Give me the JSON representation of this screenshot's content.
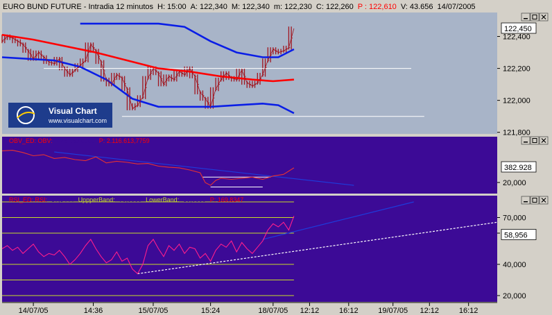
{
  "header": {
    "parts": [
      {
        "text": "EURO BUND FUTURE - Intradia 12 minutos",
        "color": "#000000"
      },
      {
        "text": "H: 15:00",
        "color": "#000000"
      },
      {
        "text": "A: 122,340",
        "color": "#000000"
      },
      {
        "text": "M: 122,340",
        "color": "#000000"
      },
      {
        "text": "m: 122,230",
        "color": "#000000"
      },
      {
        "text": "C: 122,260",
        "color": "#000000"
      },
      {
        "text": "P : 122,610",
        "color": "#ff0000"
      },
      {
        "text": "V: 43.656",
        "color": "#000000"
      },
      {
        "text": "14/07/2005",
        "color": "#000000"
      }
    ]
  },
  "logo": {
    "brand": "Visual Chart",
    "url": "www.visualchart.com"
  },
  "colors": {
    "price_bg": "#a8b4c8",
    "indicator_bg": "#3c0a96",
    "price_bars": "#a0141e",
    "moving_average": "#ff0000",
    "bands": "#0a1ee6",
    "obv_line": "#e63232",
    "rsi_line": "#ff1e8c",
    "trendline": "#1e3cdc",
    "threshold": "#c8dc28",
    "support": "#ffffff"
  },
  "chart_data": [
    {
      "type": "line",
      "panel": "price",
      "series": [
        {
          "name": "price",
          "points": [
            [
              0,
              122.37
            ],
            [
              2,
              122.4
            ],
            [
              4,
              122.39
            ],
            [
              6,
              122.37
            ],
            [
              8,
              122.35
            ],
            [
              10,
              122.31
            ],
            [
              12,
              122.26
            ],
            [
              14,
              122.3
            ],
            [
              16,
              122.27
            ],
            [
              18,
              122.24
            ],
            [
              20,
              122.23
            ],
            [
              22,
              122.26
            ],
            [
              24,
              122.2
            ],
            [
              26,
              122.16
            ],
            [
              28,
              122.19
            ],
            [
              30,
              122.22
            ],
            [
              32,
              122.25
            ],
            [
              34,
              122.35
            ],
            [
              36,
              122.31
            ],
            [
              38,
              122.24
            ],
            [
              40,
              122.13
            ],
            [
              42,
              122.1
            ],
            [
              44,
              122.16
            ],
            [
              46,
              122.14
            ],
            [
              48,
              122.07
            ],
            [
              50,
              121.95
            ],
            [
              52,
              121.97
            ],
            [
              54,
              122.02
            ],
            [
              56,
              122.14
            ],
            [
              58,
              122.2
            ],
            [
              60,
              122.17
            ],
            [
              62,
              122.1
            ],
            [
              64,
              122.15
            ],
            [
              66,
              122.13
            ],
            [
              68,
              122.18
            ],
            [
              70,
              122.16
            ],
            [
              72,
              122.2
            ],
            [
              74,
              122.15
            ],
            [
              76,
              122.05
            ],
            [
              78,
              122.01
            ],
            [
              80,
              121.96
            ],
            [
              82,
              122.07
            ],
            [
              84,
              122.13
            ],
            [
              86,
              122.17
            ],
            [
              88,
              122.14
            ],
            [
              90,
              122.13
            ],
            [
              92,
              122.19
            ],
            [
              94,
              122.11
            ],
            [
              96,
              122.09
            ],
            [
              98,
              122.11
            ],
            [
              100,
              122.16
            ],
            [
              102,
              122.25
            ],
            [
              104,
              122.32
            ],
            [
              106,
              122.3
            ],
            [
              108,
              122.31
            ],
            [
              110,
              122.33
            ],
            [
              112,
              122.45
            ]
          ]
        },
        {
          "name": "media",
          "points": [
            [
              0,
              122.41
            ],
            [
              12,
              122.38
            ],
            [
              24,
              122.34
            ],
            [
              36,
              122.3
            ],
            [
              48,
              122.25
            ],
            [
              60,
              122.2
            ],
            [
              72,
              122.18
            ],
            [
              84,
              122.15
            ],
            [
              96,
              122.13
            ],
            [
              104,
              122.12
            ],
            [
              112,
              122.13
            ]
          ]
        },
        {
          "name": "banda-superior",
          "points": [
            [
              30,
              122.48
            ],
            [
              40,
              122.48
            ],
            [
              50,
              122.48
            ],
            [
              60,
              122.48
            ],
            [
              70,
              122.46
            ],
            [
              80,
              122.37
            ],
            [
              90,
              122.3
            ],
            [
              100,
              122.27
            ],
            [
              106,
              122.27
            ],
            [
              112,
              122.32
            ]
          ]
        },
        {
          "name": "banda-inferior",
          "points": [
            [
              0,
              122.27
            ],
            [
              10,
              122.26
            ],
            [
              20,
              122.25
            ],
            [
              30,
              122.21
            ],
            [
              40,
              122.13
            ],
            [
              50,
              122.01
            ],
            [
              60,
              121.96
            ],
            [
              70,
              121.96
            ],
            [
              80,
              121.96
            ],
            [
              90,
              121.97
            ],
            [
              100,
              121.98
            ],
            [
              106,
              121.97
            ],
            [
              112,
              121.92
            ]
          ]
        },
        {
          "name": "soporte-superior",
          "points": [
            [
              16,
              122.2
            ],
            [
              157,
              122.2
            ]
          ]
        },
        {
          "name": "soporte-inferior",
          "points": [
            [
              46,
              121.9
            ],
            [
              162,
              121.9
            ]
          ]
        }
      ],
      "current_value": "122,450",
      "ylim": [
        121.79,
        122.55
      ],
      "yticks": [
        "122,400",
        "122,200",
        "122,000",
        "121,800"
      ]
    },
    {
      "type": "line",
      "panel": "obv",
      "legend": [
        {
          "text": "OBV_ED: OBV:",
          "color": "#ff0000"
        },
        {
          "text": "426.160,0000",
          "color": "#3c0a96"
        },
        {
          "text": "P: 2.116.613,7759",
          "color": "#ff0000"
        }
      ],
      "series": [
        {
          "name": "obv",
          "points": [
            [
              0,
              0.78
            ],
            [
              4,
              0.79
            ],
            [
              8,
              0.75
            ],
            [
              12,
              0.69
            ],
            [
              16,
              0.71
            ],
            [
              20,
              0.64
            ],
            [
              24,
              0.66
            ],
            [
              28,
              0.62
            ],
            [
              32,
              0.6
            ],
            [
              36,
              0.67
            ],
            [
              40,
              0.56
            ],
            [
              44,
              0.59
            ],
            [
              48,
              0.57
            ],
            [
              52,
              0.54
            ],
            [
              56,
              0.55
            ],
            [
              60,
              0.5
            ],
            [
              64,
              0.48
            ],
            [
              68,
              0.47
            ],
            [
              72,
              0.43
            ],
            [
              76,
              0.38
            ],
            [
              78,
              0.2
            ],
            [
              80,
              0.15
            ],
            [
              82,
              0.24
            ],
            [
              84,
              0.28
            ],
            [
              88,
              0.26
            ],
            [
              92,
              0.28
            ],
            [
              96,
              0.3
            ],
            [
              100,
              0.26
            ],
            [
              104,
              0.32
            ],
            [
              108,
              0.35
            ],
            [
              112,
              0.47
            ]
          ]
        },
        {
          "name": "tendencia",
          "points": [
            [
              20,
              0.76
            ],
            [
              135,
              0.15
            ]
          ]
        },
        {
          "name": "soporte-1",
          "points": [
            [
              77,
              0.3
            ],
            [
              103,
              0.3
            ]
          ]
        },
        {
          "name": "soporte-2",
          "points": [
            [
              80,
              0.12
            ],
            [
              100,
              0.12
            ]
          ]
        }
      ],
      "current_value": "382.928",
      "ylim": [
        0,
        1
      ],
      "yticks": [
        "",
        "20,000"
      ]
    },
    {
      "type": "line",
      "panel": "rsi",
      "legend": [
        {
          "text": "RSI_ED: RSI:",
          "color": "#ff0000"
        },
        {
          "text": "57,5444",
          "color": "#3c0a96"
        },
        {
          "text": "UppperBand:",
          "color": "#c8dc28"
        },
        {
          "text": "70,0000",
          "color": "#3c0a96"
        },
        {
          "text": "LowerBand:",
          "color": "#c8dc28"
        },
        {
          "text": "30,0000",
          "color": "#3c0a96"
        },
        {
          "text": "P: 169,8347",
          "color": "#ff0000"
        }
      ],
      "series": [
        {
          "name": "rsi",
          "points": [
            [
              0,
              50
            ],
            [
              2,
              52
            ],
            [
              4,
              49
            ],
            [
              6,
              51
            ],
            [
              8,
              47
            ],
            [
              10,
              50
            ],
            [
              12,
              53
            ],
            [
              14,
              48
            ],
            [
              16,
              45
            ],
            [
              18,
              47
            ],
            [
              20,
              46
            ],
            [
              22,
              49
            ],
            [
              24,
              45
            ],
            [
              26,
              40
            ],
            [
              28,
              43
            ],
            [
              30,
              47
            ],
            [
              32,
              52
            ],
            [
              34,
              56
            ],
            [
              36,
              50
            ],
            [
              38,
              45
            ],
            [
              40,
              41
            ],
            [
              42,
              43
            ],
            [
              44,
              48
            ],
            [
              46,
              42
            ],
            [
              48,
              44
            ],
            [
              50,
              37
            ],
            [
              52,
              34
            ],
            [
              54,
              40
            ],
            [
              56,
              52
            ],
            [
              58,
              56
            ],
            [
              60,
              50
            ],
            [
              62,
              45
            ],
            [
              64,
              52
            ],
            [
              66,
              49
            ],
            [
              68,
              53
            ],
            [
              70,
              47
            ],
            [
              72,
              51
            ],
            [
              74,
              50
            ],
            [
              76,
              44
            ],
            [
              78,
              47
            ],
            [
              80,
              42
            ],
            [
              82,
              49
            ],
            [
              84,
              53
            ],
            [
              86,
              51
            ],
            [
              88,
              55
            ],
            [
              90,
              48
            ],
            [
              92,
              54
            ],
            [
              94,
              50
            ],
            [
              96,
              47
            ],
            [
              98,
              51
            ],
            [
              100,
              55
            ],
            [
              102,
              62
            ],
            [
              104,
              66
            ],
            [
              106,
              64
            ],
            [
              108,
              67
            ],
            [
              110,
              62
            ],
            [
              112,
              71
            ]
          ]
        },
        {
          "name": "tendencia-rsi",
          "points": [
            [
              100,
              56
            ],
            [
              158,
              80
            ]
          ]
        },
        {
          "name": "soporte-rsi",
          "points": [
            [
              52,
              34
            ],
            [
              190,
              67
            ]
          ]
        }
      ],
      "current_value": "58,956",
      "ylim": [
        16,
        84
      ],
      "levels": [
        80,
        70,
        60,
        40,
        30,
        20
      ],
      "yticks": [
        "70,000",
        "60,000",
        "40,000",
        "20,000"
      ]
    }
  ],
  "x_axis": {
    "x_min": 0,
    "x_max": 190,
    "labels": [
      {
        "text": "14/07/05",
        "x": 12
      },
      {
        "text": "14:36",
        "x": 35
      },
      {
        "text": "15/07/05",
        "x": 58
      },
      {
        "text": "15:24",
        "x": 80
      },
      {
        "text": "18/07/05",
        "x": 104
      },
      {
        "text": "12:12",
        "x": 118
      },
      {
        "text": "16:12",
        "x": 133
      },
      {
        "text": "19/07/05",
        "x": 150
      },
      {
        "text": "12:12",
        "x": 164
      },
      {
        "text": "16:12",
        "x": 179
      }
    ]
  }
}
